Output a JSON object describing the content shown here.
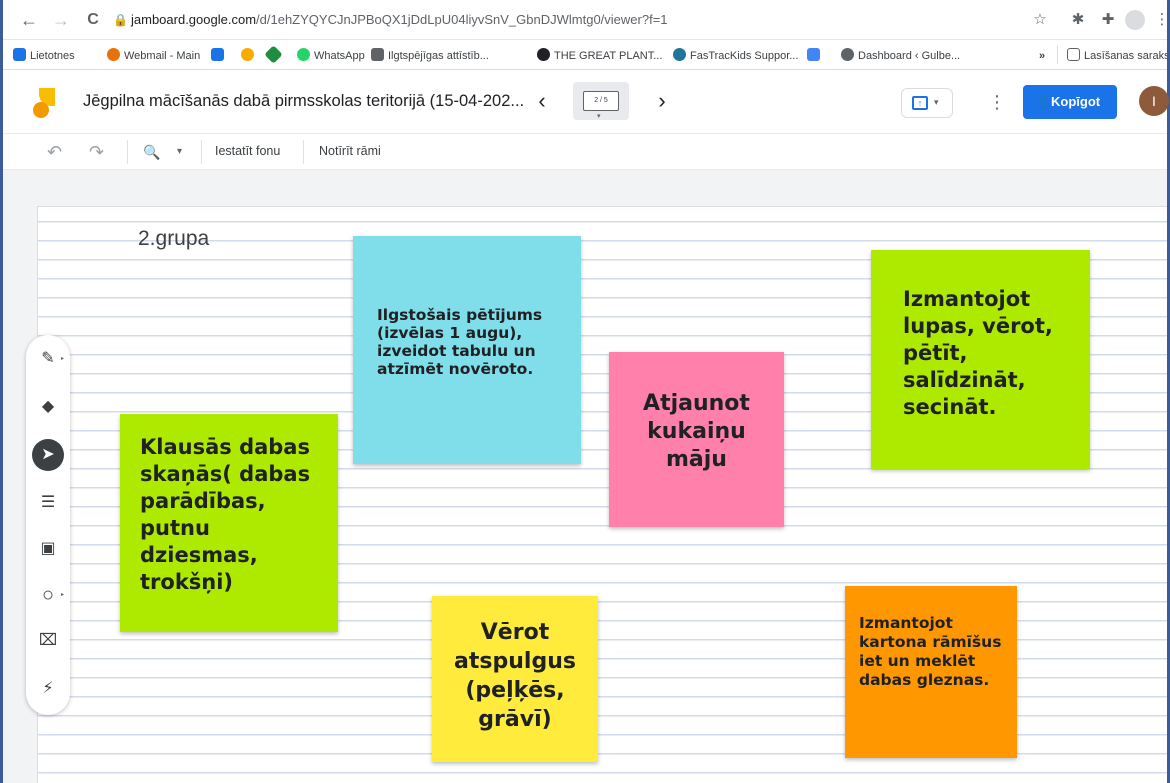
{
  "browser": {
    "url_host": "jamboard.google.com",
    "url_path": "/d/1ehZYQYCJnJPBoQX1jDdLpU04liyvSnV_GbnDJWlmtg0/viewer?f=1",
    "back_icon": "←",
    "forward_icon": "→",
    "reload_icon": "C",
    "lock_icon": "🔒",
    "star_icon": "☆",
    "bookmarks": [
      {
        "label": "Lietotnes",
        "color": "#1a73e8"
      },
      {
        "label": "Webmail - Main",
        "color": "#e8710a"
      },
      {
        "label": "",
        "color": "#1a73e8"
      },
      {
        "label": "",
        "color": "#f9ab00"
      },
      {
        "label": "",
        "color": "#1e8e3e"
      },
      {
        "label": "WhatsApp",
        "color": "#25d366"
      },
      {
        "label": "Ilgtspējīgas attīstīb...",
        "color": "#5f6368"
      },
      {
        "label": "THE GREAT PLANT...",
        "color": "#202124"
      },
      {
        "label": "FasTracKids Suppor...",
        "color": "#21759b"
      },
      {
        "label": "",
        "color": "#4285f4"
      },
      {
        "label": "Dashboard ‹ Gulbe...",
        "color": "#5f6368"
      },
      {
        "label": "»",
        "color": ""
      },
      {
        "label": "Lasīšanas saraksts",
        "color": "#5f6368"
      }
    ]
  },
  "header": {
    "title": "Jēgpilna mācīšanās dabā pirmsskolas teritorijā (15-04-202...",
    "prev_icon": "‹",
    "next_icon": "›",
    "frame_indicator": "2 / 5",
    "share_label": "Kopīgot",
    "avatar_initial": "I",
    "more_icon": "⋮"
  },
  "toolbar": {
    "undo_icon": "↶",
    "redo_icon": "↷",
    "zoom_icon": "🔍",
    "zoom_caret": "▾",
    "set_background": "Iestatīt fonu",
    "clear_frame": "Notīrīt rāmi"
  },
  "board": {
    "label": "2.grupa",
    "notes": [
      {
        "text": "Klausās dabas skaņās( dabas parādības, putnu dziesmas, trokšņi)",
        "color": "#aeea00"
      },
      {
        "text": "Ilgstošais pētījums (izvēlas 1 augu), izveidot tabulu un atzīmēt novēroto.",
        "color": "#80deea"
      },
      {
        "text": "Atjaunot kukaiņu māju",
        "color": "#ff80ab"
      },
      {
        "text": "Izmantojot lupas, vērot, pētīt, salīdzināt, secināt.",
        "color": "#aeea00"
      },
      {
        "text": "Vērot atspulgus (peļķēs, grāvī)",
        "color": "#ffeb3b"
      },
      {
        "text": "Izmantojot kartona rāmīšus iet un meklēt dabas gleznas.",
        "color": "#ff9800"
      }
    ]
  },
  "tools": [
    {
      "name": "pen",
      "icon": "✎"
    },
    {
      "name": "eraser",
      "icon": "◆"
    },
    {
      "name": "select",
      "icon": "➤"
    },
    {
      "name": "sticky-note",
      "icon": "☰"
    },
    {
      "name": "image",
      "icon": "▣"
    },
    {
      "name": "circle",
      "icon": "○"
    },
    {
      "name": "text-box",
      "icon": "⌧"
    },
    {
      "name": "laser",
      "icon": "⚡"
    }
  ]
}
